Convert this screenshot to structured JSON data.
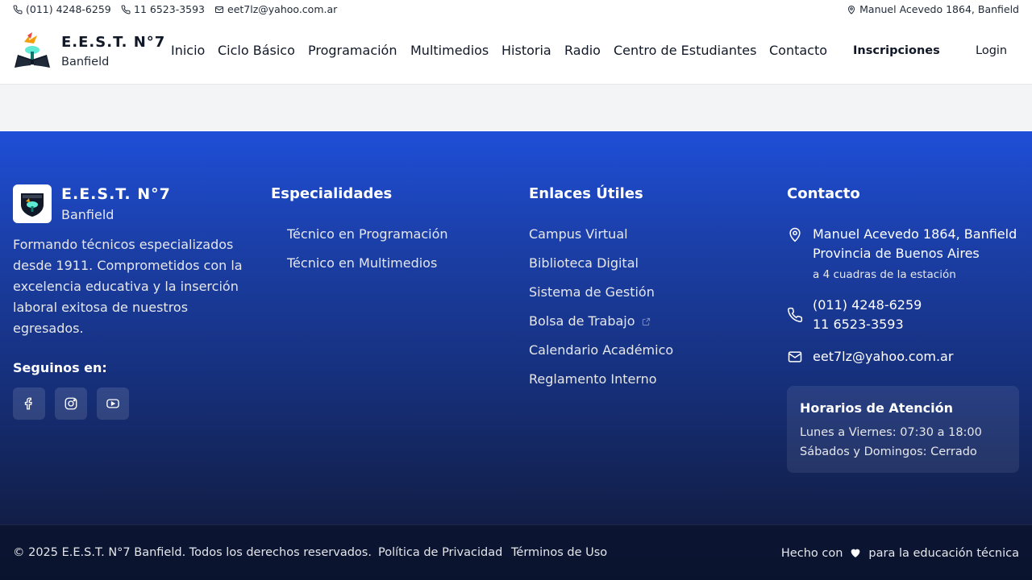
{
  "topbar": {
    "phone1": "(011) 4248-6259",
    "phone2": "11 6523-3593",
    "email": "eet7lz@yahoo.com.ar",
    "address": "Manuel Acevedo 1864, Banfield"
  },
  "header": {
    "title": "E.E.S.T. N°7",
    "subtitle": "Banfield",
    "nav": [
      "Inicio",
      "Ciclo Básico",
      "Programación",
      "Multimedios",
      "Historia",
      "Radio",
      "Centro de Estudiantes",
      "Contacto"
    ],
    "cta": "Inscripciones",
    "login": "Login"
  },
  "footer": {
    "brand": {
      "title": "E.E.S.T. N°7",
      "subtitle": "Banfield",
      "description": "Formando técnicos especializados desde 1911. Comprometidos con la excelencia educativa y la inserción laboral exitosa de nuestros egresados.",
      "follow": "Seguinos en:",
      "social": [
        "facebook-icon",
        "instagram-icon",
        "youtube-icon"
      ]
    },
    "especialidades": {
      "title": "Especialidades",
      "items": [
        "Técnico en Programación",
        "Técnico en Multimedios"
      ]
    },
    "enlaces": {
      "title": "Enlaces Útiles",
      "items": [
        "Campus Virtual",
        "Biblioteca Digital",
        "Sistema de Gestión",
        "Bolsa de Trabajo",
        "Calendario Académico",
        "Reglamento Interno"
      ]
    },
    "contacto": {
      "title": "Contacto",
      "address1": "Manuel Acevedo 1864, Banfield",
      "address2": "Provincia de Buenos Aires",
      "address_note": "a 4 cuadras de la estación",
      "phone1": "(011) 4248-6259",
      "phone2": "11 6523-3593",
      "email": "eet7lz@yahoo.com.ar",
      "hours_title": "Horarios de Atención",
      "hours_weekdays": "Lunes a Viernes: 07:30 a 18:00",
      "hours_weekend": "Sábados y Domingos: Cerrado"
    },
    "bottom": {
      "copyright": "© 2025 E.E.S.T. N°7 Banfield. Todos los derechos reservados.",
      "privacy": "Política de Privacidad",
      "terms": "Términos de Uso",
      "made_with_prefix": "Hecho con",
      "made_with_suffix": "para la educación técnica"
    }
  },
  "colors": {
    "footer_top": "#1f4fd8",
    "footer_bottom": "#0f1a3a",
    "page_bg": "#f3f4f6"
  }
}
